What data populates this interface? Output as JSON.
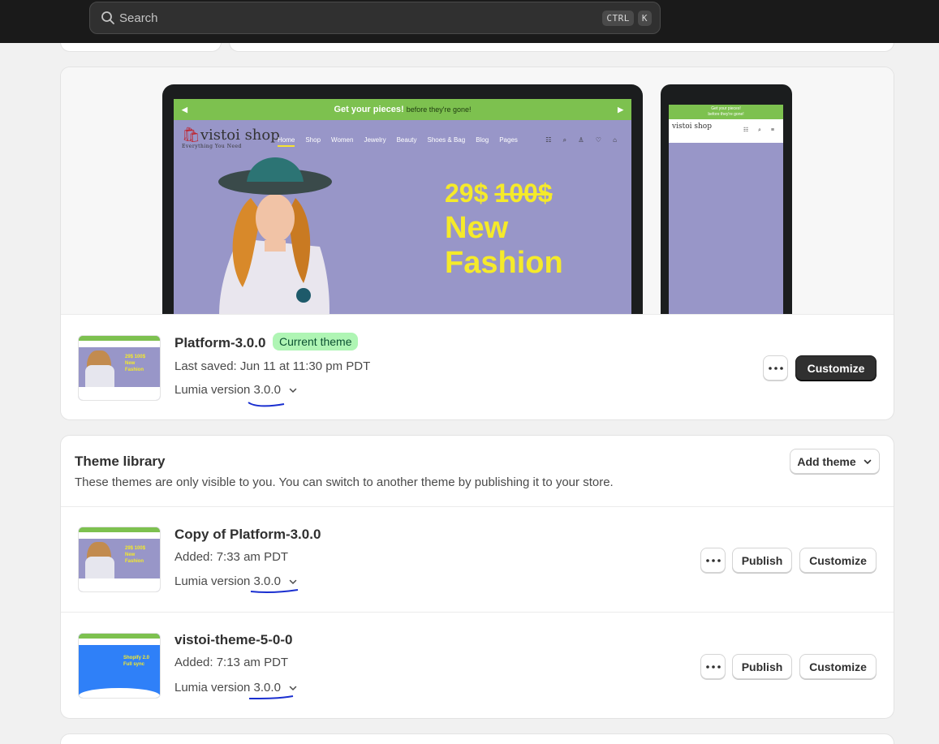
{
  "search": {
    "placeholder": "Search",
    "shortcut_ctrl": "CTRL",
    "shortcut_key": "K"
  },
  "current_theme": {
    "preview": {
      "banner_text": "Get your pieces!",
      "banner_small": "before they're gone!",
      "logo": "vistoi shop",
      "logo_tagline": "Everything You Need",
      "nav": [
        "Home",
        "Shop",
        "Women",
        "Jewelry",
        "Beauty",
        "Shoes & Bag",
        "Blog",
        "Pages"
      ],
      "price_new": "29$",
      "price_old": "100$",
      "headline_1": "New",
      "headline_2": "Fashion",
      "phone_banner_1": "Get your pieces!",
      "phone_banner_2": "before they're gone!",
      "phone_logo": "vistoi shop"
    },
    "name": "Platform-3.0.0",
    "badge": "Current theme",
    "last_saved": "Last saved: Jun 11 at 11:30 pm PDT",
    "version_label": "Lumia version 3.0.0",
    "customize_label": "Customize"
  },
  "library": {
    "title": "Theme library",
    "description": "These themes are only visible to you. You can switch to another theme by publishing it to your store.",
    "add_theme_label": "Add theme",
    "themes": [
      {
        "name": "Copy of Platform-3.0.0",
        "added": "Added: 7:33 am PDT",
        "version": "Lumia version 3.0.0",
        "publish": "Publish",
        "customize": "Customize",
        "thumb_text_1": "29$ 100$",
        "thumb_text_2": "New",
        "thumb_text_3": "Fashion"
      },
      {
        "name": "vistoi-theme-5-0-0",
        "added": "Added: 7:13 am PDT",
        "version": "Lumia version 3.0.0",
        "publish": "Publish",
        "customize": "Customize",
        "thumb_text_1": "Shopify 2.0",
        "thumb_text_2": "Full sync"
      }
    ]
  },
  "colors": {
    "topbar": "#1a1a1a",
    "banner_green": "#7dc14f",
    "preview_purple": "#9896c8",
    "headline_yellow": "#f5ea2a",
    "badge_green": "#aff5b4",
    "scribble_blue": "#1a2fd0"
  }
}
